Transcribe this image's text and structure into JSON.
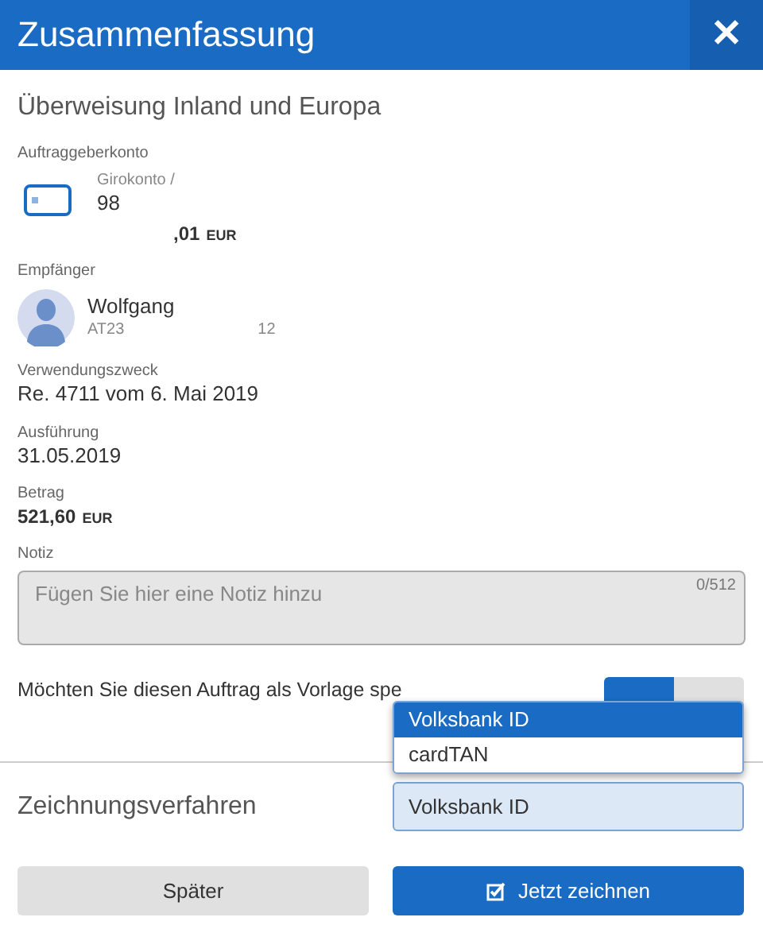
{
  "header": {
    "title": "Zusammenfassung",
    "close": "✕"
  },
  "subtitle": "Überweisung Inland und Europa",
  "account": {
    "label": "Auftraggeberkonto",
    "name": "Girokonto /",
    "number": "98",
    "balance": ",01",
    "currency": "EUR"
  },
  "recipient": {
    "label": "Empfänger",
    "name": "Wolfgang",
    "iban_start": "AT23",
    "iban_end": "12"
  },
  "fields": [
    {
      "label": "Verwendungszweck",
      "value": "Re. 4711 vom 6. Mai  2019",
      "kind": "plain"
    },
    {
      "label": "Ausführung",
      "value": "31.05.2019",
      "kind": "plain"
    },
    {
      "label": "Betrag",
      "value": "521,60",
      "currency": "EUR",
      "kind": "amount"
    }
  ],
  "note": {
    "label": "Notiz",
    "placeholder": "Fügen Sie hier eine Notiz hinzu",
    "counter": "0/512"
  },
  "save_template": {
    "question": "Möchten Sie diesen Auftrag als Vorlage spe",
    "options": [
      {
        "selected": true
      },
      {
        "selected": false
      }
    ]
  },
  "signing": {
    "label": "Zeichnungsverfahren",
    "value": "Volksbank ID",
    "expanded": true,
    "options": [
      {
        "label": "Volksbank ID",
        "selected": true
      },
      {
        "label": "cardTAN",
        "selected": false
      }
    ]
  },
  "buttons": [
    {
      "label": "Später",
      "kind": "secondary"
    },
    {
      "label": "Jetzt zeichnen",
      "kind": "primary"
    }
  ]
}
